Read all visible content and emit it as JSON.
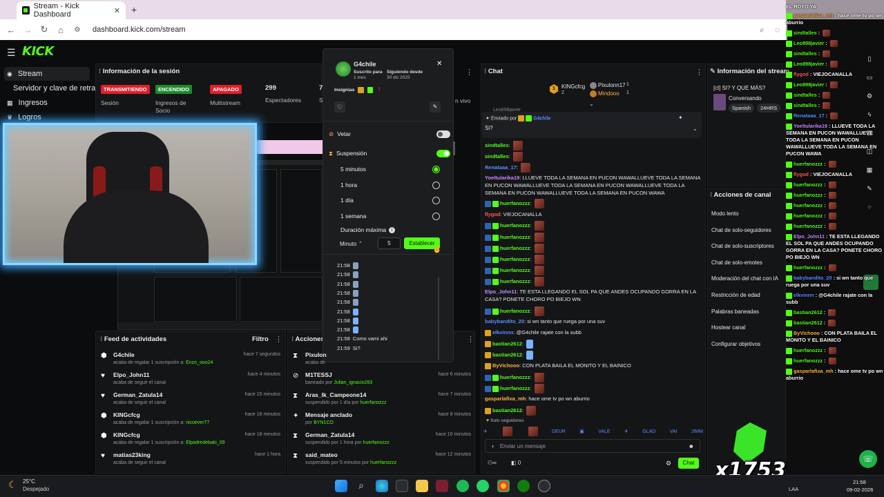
{
  "browser": {
    "tab_title": "Stream - Kick Dashboard",
    "url": "dashboard.kick.com/stream",
    "new_tab": "+",
    "close": "✕"
  },
  "kick": {
    "logo": "KICK"
  },
  "sidebar": {
    "items": [
      {
        "label": "Stream",
        "icon": "broadcast-icon"
      },
      {
        "label": "Servidor y clave de retransmisión",
        "icon": ""
      },
      {
        "label": "Ingresos",
        "icon": "money-icon"
      },
      {
        "label": "Logros",
        "icon": "trophy-icon"
      }
    ]
  },
  "session": {
    "title": "Información de la sesión",
    "badges": [
      {
        "text": "TRANSMITIENDO",
        "label": "Sesión",
        "color": "#e0202a"
      },
      {
        "text": "ENCENDIDO",
        "label": "Ingresos de Socio",
        "color": "#1a7a2a"
      },
      {
        "text": "APAGADO",
        "label": "Multistream",
        "color": "#e0202a"
      }
    ],
    "viewers_value": "299",
    "viewers_label": "Espectadores",
    "partial_value": "7",
    "partial_label": "S",
    "live_label": "n vivo"
  },
  "feed": {
    "title": "Feed de actividades",
    "filter": "Filtro",
    "rows": [
      {
        "name": "G4chile",
        "time": "hace 7 segundos",
        "pre": "acaba de regalar 1 suscripción a: ",
        "hl": "Enzo_ooo24",
        "icon": "gift-icon"
      },
      {
        "name": "Elpo_John11",
        "time": "hace 4 minutos",
        "pre": "acaba de seguir el canal",
        "hl": "",
        "icon": "heart-icon"
      },
      {
        "name": "German_Zatula14",
        "time": "hace 15 minutos",
        "pre": "acaba de seguir el canal",
        "hl": "",
        "icon": "heart-icon"
      },
      {
        "name": "KINGcfcg",
        "time": "hace 18 minutos",
        "pre": "acaba de regalar 1 suscripción a: ",
        "hl": "nicoever77",
        "icon": "gift-icon"
      },
      {
        "name": "KINGcfcg",
        "time": "hace 18 minutos",
        "pre": "acaba de regalar 1 suscripción a: ",
        "hl": "Elpadredebaki_09",
        "icon": "gift-icon"
      },
      {
        "name": "matias23king",
        "time": "hace 1 hora",
        "pre": "acaba de seguir el canal",
        "hl": "",
        "icon": "heart-icon"
      }
    ]
  },
  "actions": {
    "title": "Acciones",
    "rows": [
      {
        "name": "Pixulon",
        "time": "",
        "pre": "acaba de",
        "hl": "",
        "icon": "hourglass-icon"
      },
      {
        "name": "M1TESSJ",
        "time": "hace 6 minutos",
        "pre": "baneado por ",
        "hl": "Julian_ignacio283",
        "icon": "ban-icon"
      },
      {
        "name": "Aras_Ik_Campeone14",
        "time": "hace 7 minutos",
        "pre": "suspendido por 1 día por ",
        "hl": "huerfanozzz",
        "icon": "hourglass-icon"
      },
      {
        "name": "Mensaje anclado",
        "time": "hace 8 minutos",
        "pre": "por ",
        "hl": "BYN1CO",
        "icon": "pin-icon"
      },
      {
        "name": "German_Zatula14",
        "time": "hace 10 minutos",
        "pre": "suspendido por 1 hora por ",
        "hl": "huerfanozzz",
        "icon": "hourglass-icon"
      },
      {
        "name": "said_mateo",
        "time": "hace 12 minutos",
        "pre": "suspendido por 5 minutos por ",
        "hl": "huerfanozzz",
        "icon": "hourglass-icon"
      }
    ]
  },
  "modal": {
    "username": "G4chile",
    "subscribed_label": "Suscrito para",
    "subscribed_value": "1 mes",
    "following_label": "Siguiendo desde",
    "following_value": "30 dic 2025",
    "insignias_label": "Insignias",
    "vetar": "Vetar",
    "suspension": "Suspensión",
    "options": [
      "5 minutos",
      "1 hora",
      "1 día",
      "1 semana"
    ],
    "duracion": "Duración máxima",
    "unit": "Minuto",
    "amount": "5",
    "set_button": "Establecer",
    "history": [
      {
        "time": "21:58",
        "text": ""
      },
      {
        "time": "21:58",
        "text": ""
      },
      {
        "time": "21:58",
        "text": ""
      },
      {
        "time": "21:58",
        "text": ""
      },
      {
        "time": "21:58",
        "text": ""
      },
      {
        "time": "21:58",
        "text": ""
      },
      {
        "time": "21:58",
        "text": ""
      },
      {
        "time": "21:58",
        "text": ""
      },
      {
        "time": "21:58",
        "text": "Como vami ahi"
      },
      {
        "time": "21:59",
        "text": "Si?"
      }
    ]
  },
  "chat": {
    "title": "Chat",
    "top_gifters": [
      {
        "name": "KINGcfcg",
        "count": "2",
        "rank": "1"
      },
      {
        "name": "Pixulonn17",
        "count": "1",
        "rank": ""
      },
      {
        "name": "Mindooo",
        "count": "1",
        "rank": ""
      }
    ],
    "pinned_by_label": "Enviado por",
    "pinned_by": "G4chile",
    "pinned_text": "Si?",
    "partial_top": "Leo898javier",
    "messages": [
      {
        "user": "sindtalles",
        "cls": "u-green",
        "text": "",
        "emote": "img"
      },
      {
        "user": "sindtalles",
        "cls": "u-green",
        "text": "",
        "emote": "img"
      },
      {
        "user": "Renataaa_17",
        "cls": "u-blue",
        "text": "",
        "emote": "img"
      },
      {
        "user": "Yoeltularika19",
        "cls": "u-purple",
        "text": "LLUEVE TODA LA SEMANA EN PUCON WAWALLUEVE TODA LA SEMANA EN PUCON WAWALLUEVE TODA LA SEMANA EN PUCON WAWALLUEVE TODA LA SEMANA EN PUCON WAWALLUEVE TODA LA SEMANA EN PUCON WAWA",
        "emote": ""
      },
      {
        "user": "huerfanozzz",
        "cls": "u-green",
        "text": "",
        "emote": "img"
      },
      {
        "user": "flygod",
        "cls": "u-red",
        "text": "VIEJOCANALLA",
        "emote": ""
      },
      {
        "user": "huerfanozzz",
        "cls": "u-green",
        "text": "",
        "emote": "img"
      },
      {
        "user": "huerfanozzz",
        "cls": "u-green",
        "text": "",
        "emote": "img"
      },
      {
        "user": "huerfanozzz",
        "cls": "u-green",
        "text": "",
        "emote": "img"
      },
      {
        "user": "huerfanozzz",
        "cls": "u-green",
        "text": "",
        "emote": "img"
      },
      {
        "user": "huerfanozzz",
        "cls": "u-green",
        "text": "",
        "emote": "img"
      },
      {
        "user": "huerfanozzz",
        "cls": "u-green",
        "text": "",
        "emote": "img"
      },
      {
        "user": "Elpo_John11",
        "cls": "u-purple",
        "text": "TE ESTA LLEGANDO EL SOL PA QUE ANDES OCUPANDO GORRA EN LA CASA? PONETE CHORO PO BIEJO WN",
        "emote": ""
      },
      {
        "user": "huerfanozzz",
        "cls": "u-green",
        "text": "",
        "emote": "img"
      },
      {
        "user": "babybandito_20",
        "cls": "u-blue",
        "text": "si wn tanto que ruega por una suv",
        "emote": ""
      },
      {
        "user": "elkvinnn",
        "cls": "u-blue",
        "text": "@G4chile rajate con la subb",
        "emote": ""
      },
      {
        "user": "bastian2612",
        "cls": "u-green",
        "text": "",
        "emote": "blue"
      },
      {
        "user": "bastian2612",
        "cls": "u-green",
        "text": "",
        "emote": "blue"
      },
      {
        "user": "ByVichooo",
        "cls": "u-orange",
        "text": "CON PLATA BAILA EL MONITO Y EL BAINICO",
        "emote": ""
      },
      {
        "user": "huerfanozzz",
        "cls": "u-green",
        "text": "",
        "emote": "img"
      },
      {
        "user": "huerfanozzz",
        "cls": "u-green",
        "text": "",
        "emote": "img"
      },
      {
        "user": "gasparlafixa_mh",
        "cls": "u-orange",
        "text": "hace ome tv po wn aburrio",
        "emote": ""
      },
      {
        "user": "bastian2612",
        "cls": "u-green",
        "text": "",
        "emote": "img"
      }
    ],
    "followers_only": "Solo seguidores",
    "input_placeholder": "Enviar un mensaje",
    "send_button": "Chat",
    "counter": "0"
  },
  "stream_info": {
    "title": "Información del stream",
    "stream_title": "[cl] SI? Y QUE MÁS?",
    "category": "Conversando",
    "tags": [
      "Spanish",
      "24HRS"
    ]
  },
  "channel_actions": {
    "title": "Acciones de canal",
    "items": [
      "Modo lento",
      "Chat de solo-seguidores",
      "Chat de solo-suscriptores",
      "Chat de solo-emotes",
      "Moderación del chat con IA",
      "Restricción de edad",
      "Palabras baneadas",
      "Hostear canal",
      "Configurar objetivos"
    ]
  },
  "overlay_chat": {
    "header": "EL ROYO YA",
    "lines": [
      {
        "user": "gasparlafixa_mh",
        "cls": "u-orange",
        "text": "hace ome tv po wn aburrio"
      },
      {
        "user": "sindtalles",
        "cls": "u-green",
        "text": ""
      },
      {
        "user": "Leo898javier",
        "cls": "u-green",
        "text": ""
      },
      {
        "user": "sindtalles",
        "cls": "u-green",
        "text": ""
      },
      {
        "user": "Leo898javier",
        "cls": "u-green",
        "text": ""
      },
      {
        "user": "flygod",
        "cls": "u-red",
        "text": "VIEJOCANALLA"
      },
      {
        "user": "Leo898javier",
        "cls": "u-green",
        "text": ""
      },
      {
        "user": "sindtalles",
        "cls": "u-green",
        "text": ""
      },
      {
        "user": "sindtalles",
        "cls": "u-green",
        "text": ""
      },
      {
        "user": "Renataaa_17",
        "cls": "u-blue",
        "text": ""
      },
      {
        "user": "Yoeltularika19",
        "cls": "u-purple",
        "text": "LLUEVE TODA LA SEMANA EN PUCON WAWALLUEVE TODA LA SEMANA EN PUCON WAWALLUEVE TODA LA SEMANA EN PUCON WAWA"
      },
      {
        "user": "huerfanozzz",
        "cls": "u-green",
        "text": ""
      },
      {
        "user": "flygod",
        "cls": "u-red",
        "text": "VIEJOCANALLA"
      },
      {
        "user": "huerfanozzz",
        "cls": "u-green",
        "text": ""
      },
      {
        "user": "huerfanozzz",
        "cls": "u-green",
        "text": ""
      },
      {
        "user": "huerfanozzz",
        "cls": "u-green",
        "text": ""
      },
      {
        "user": "huerfanozzz",
        "cls": "u-green",
        "text": ""
      },
      {
        "user": "huerfanozzz",
        "cls": "u-green",
        "text": ""
      },
      {
        "user": "Elpo_John11",
        "cls": "u-purple",
        "text": "TE ESTA LLEGANDO EL SOL PA QUE ANDES OCUPANDO GORRA EN LA CASA? PONETE CHORO PO BIEJO WN"
      },
      {
        "user": "huerfanozzz",
        "cls": "u-green",
        "text": ""
      },
      {
        "user": "babybandito_20",
        "cls": "u-blue",
        "text": "si wn tanto que ruega por una suv"
      },
      {
        "user": "elkvinnn",
        "cls": "u-blue",
        "text": "@G4chile rajate con la subb"
      },
      {
        "user": "bastian2612",
        "cls": "u-green",
        "text": ""
      },
      {
        "user": "bastian2612",
        "cls": "u-green",
        "text": ""
      },
      {
        "user": "ByVichooo",
        "cls": "u-orange",
        "text": "CON PLATA BAILA EL MONITO Y EL BAINICO"
      },
      {
        "user": "huerfanozzz",
        "cls": "u-green",
        "text": ""
      },
      {
        "user": "huerfanozzz",
        "cls": "u-green",
        "text": ""
      },
      {
        "user": "gasparlafixa_mh",
        "cls": "u-orange",
        "text": "hace ome tv po wn aburrio"
      }
    ]
  },
  "overlay_counter": "x1753",
  "taskbar": {
    "temp": "25°C",
    "weather": "Despejado",
    "time": "21:58",
    "date": "09-02-2026",
    "lang": "LAA"
  }
}
